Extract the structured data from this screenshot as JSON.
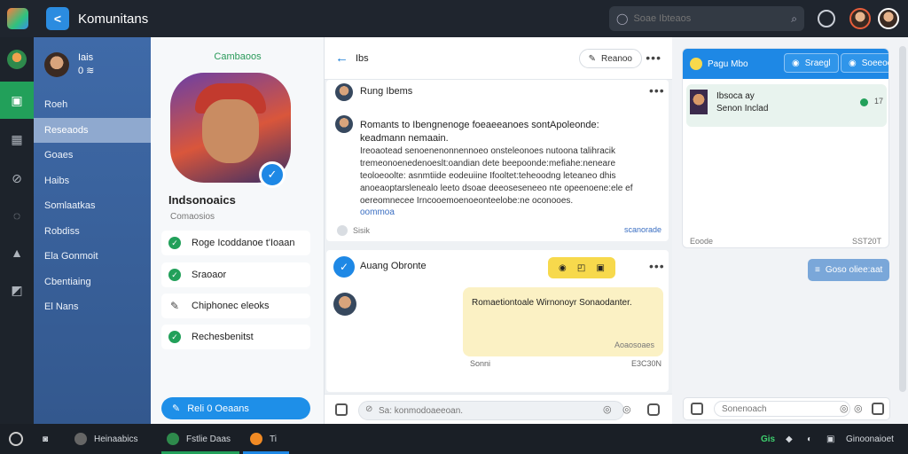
{
  "app": {
    "title": "Komunitans"
  },
  "search": {
    "placeholder": "Soae Ibteaos"
  },
  "nav": {
    "user_name": "Iais",
    "user_sub": "0 ≋",
    "items": [
      {
        "label": "Roeh"
      },
      {
        "label": "Reseaods"
      },
      {
        "label": "Goaes"
      },
      {
        "label": "Haibs"
      },
      {
        "label": "Somlaatkas"
      },
      {
        "label": "Robdiss"
      },
      {
        "label": "Ela Gonmoit"
      },
      {
        "label": "Cbentiaing"
      },
      {
        "label": "El Nans"
      }
    ]
  },
  "profile": {
    "header": "Cambaoos",
    "name": "Indsonoaics",
    "subtitle": "Comaosios",
    "items": [
      {
        "label": "Roge Icoddanoe t'Ioaan",
        "icon": "check-icon"
      },
      {
        "label": "Sraoaor",
        "icon": "check-icon"
      },
      {
        "label": "Chiphonec eleoks",
        "icon": "pencil-icon"
      },
      {
        "label": "Rechesbenitst",
        "icon": "check-icon"
      }
    ],
    "button_label": "Reli 0 Oeaans"
  },
  "feed": {
    "header_title": "Ibs",
    "header_button": "Reanoo",
    "post1": {
      "author": "Rung Ibems",
      "lead": "Romants to Ibengnenoge foeaeeanoes sontApoleonde: keadmann nemaain.",
      "body": "Ireoaotead senoenenonnennoeo onsteleonoes nutoona talihracik tremeonoenedenoeslt:oandian dete beepoonde:mefiahe:neneare teoloeoolte: asnmtiide eodeuiine Ifooltet:teheoodng leteaneo dhis anoeaoptarslenealo leeto dsoae deeoseseneeo nte opeenoene:ele ef oereomnecee Irncooemoenoeonteelobe:ne oconooes.",
      "link": "oommoa",
      "footer": "Sisik",
      "date": "scanorade"
    },
    "post2": {
      "author": "Auang Obronte",
      "bubble_text": "Romaetiontoale Wirnonoyr Sonaodanter.",
      "bubble_meta": "Aoaosoaes",
      "meta_left": "Sonni",
      "meta_right": "E3C30N"
    },
    "composer_placeholder": "Sa: konmodoaeeoan."
  },
  "right_panel": {
    "title": "Pagu Mbo",
    "tab1": "Sraegl",
    "tab2": "Soeeoe",
    "row_line1": "Ibsoca ay",
    "row_line2": "Senon Inclad",
    "row_count": "17",
    "footer_left": "Eoode",
    "footer_right": "SST20T",
    "button_label": "Goso oliee:aat",
    "composer_placeholder": "Sonenoach"
  },
  "taskbar": {
    "item1": "Heinaabics",
    "item2": "Fstlie Daas",
    "item3": "Ti",
    "right_badge": "Gis",
    "right_label": "Ginoonaioet"
  },
  "colors": {
    "accent_blue": "#1e88e5",
    "accent_green": "#22a05a",
    "nav_blue": "#3f6aa8",
    "highlight_yellow": "#f7d94c"
  }
}
